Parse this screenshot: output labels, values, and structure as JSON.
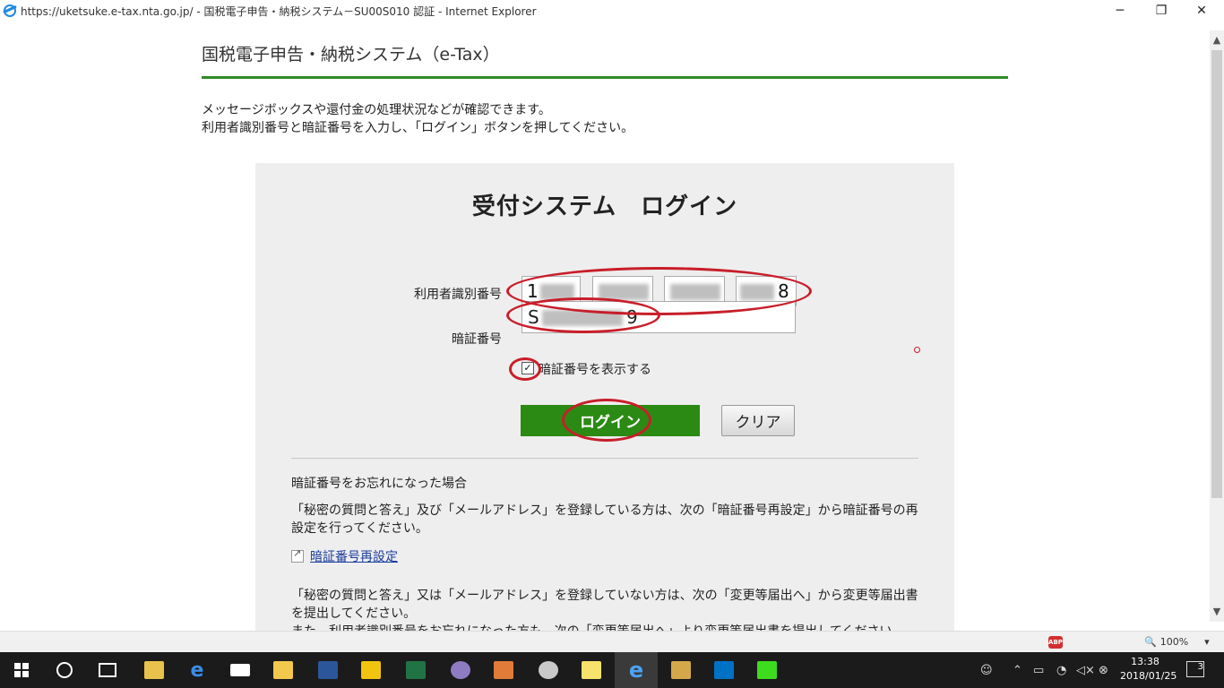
{
  "browser": {
    "title": "https://uketsuke.e-tax.nta.go.jp/ - 国税電子申告・納税システム－SU00S010 認証 - Internet Explorer",
    "minimize": "─",
    "restore": "❐",
    "close": "✕",
    "zoom": "100%",
    "adblock_label": "ABP"
  },
  "page": {
    "header": "国税電子申告・納税システム（e-Tax）",
    "intro_line1": "メッセージボックスや還付金の処理状況などが確認できます。",
    "intro_line2": "利用者識別番号と暗証番号を入力し、「ログイン」ボタンを押してください。"
  },
  "login": {
    "title": "受付システム　ログイン",
    "user_id_label": "利用者識別番号",
    "user_id_fields": [
      "1",
      "",
      "",
      "8"
    ],
    "password_label": "暗証番号",
    "password_value_start": "S",
    "password_value_end": "9",
    "show_password_label": "暗証番号を表示する",
    "show_password_checked": true,
    "checkbox_mark": "✓",
    "login_button": "ログイン",
    "clear_button": "クリア"
  },
  "help": {
    "forgot_heading": "暗証番号をお忘れになった場合",
    "forgot_text": "「秘密の質問と答え」及び「メールアドレス」を登録している方は、次の「暗証番号再設定」から暗証番号の再設定を行ってください。",
    "reset_link": "暗証番号再設定",
    "not_registered_text": "「秘密の質問と答え」又は「メールアドレス」を登録していない方は、次の「変更等届出へ」から変更等届出書を提出してください。",
    "forgot_id_text": "また、利用者識別番号をお忘れになった方も、次の「変更等届出へ」より変更等届出書を提出してください。"
  },
  "taskbar": {
    "time": "13:38",
    "date": "2018/01/25",
    "notification_count": "3",
    "colors": {
      "accent": "#2b8a13",
      "annotation": "#c81e2a",
      "header_rule": "#2e8b25"
    }
  }
}
